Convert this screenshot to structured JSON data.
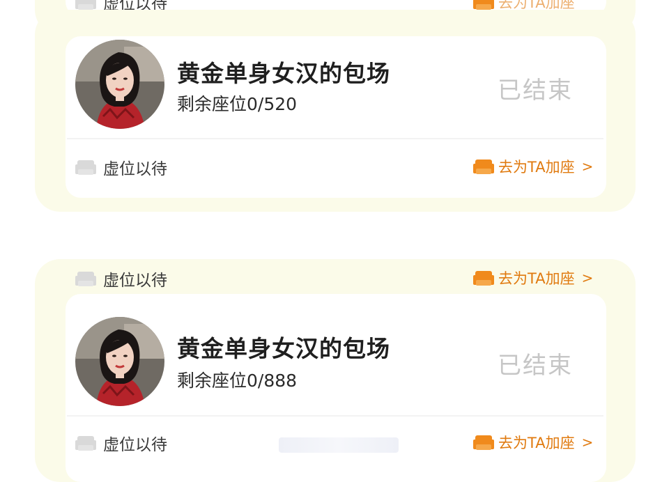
{
  "top_partial": {
    "waiting_label": "虚位以待",
    "add_seat_label": "去为TA加座"
  },
  "sessions": [
    {
      "title": "黄金单身女汉的包场",
      "seats_text": "剩余座位0/520",
      "status": "已结束",
      "waiting_label": "虚位以待",
      "add_seat_label": "去为TA加座",
      "arrow": ">"
    },
    {
      "top_waiting_label": "虚位以待",
      "top_add_seat_label": "去为TA加座",
      "title": "黄金单身女汉的包场",
      "seats_text": "剩余座位0/888",
      "status": "已结束",
      "waiting_label": "虚位以待",
      "add_seat_label": "去为TA加座",
      "arrow": ">"
    }
  ],
  "colors": {
    "accent": "#e07a0f",
    "status_gray": "#c6c6c6",
    "card_bg": "#fbfbe9"
  },
  "icons": {
    "seat_empty": "sofa-gray-icon",
    "seat_add": "sofa-orange-icon"
  }
}
